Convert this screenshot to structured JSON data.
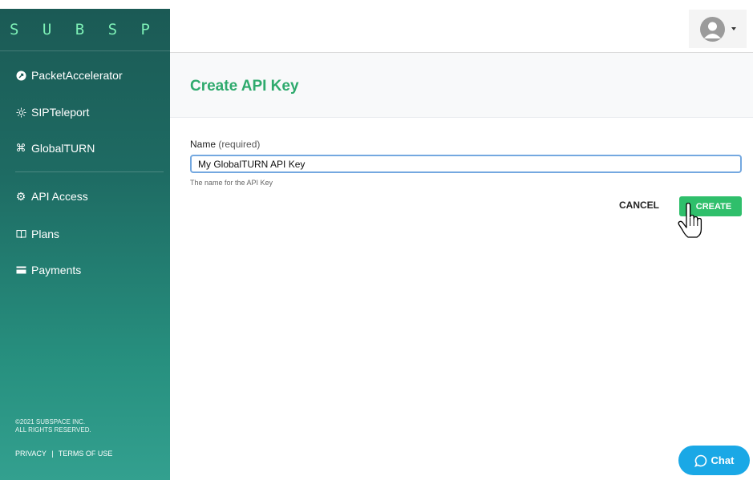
{
  "sidebar": {
    "logo_text": "SUBSPACE",
    "items": [
      {
        "label": "PacketAccelerator",
        "icon": "rocket-icon"
      },
      {
        "label": "SIPTeleport",
        "icon": "sun-icon"
      },
      {
        "label": "GlobalTURN",
        "icon": "command-icon"
      },
      {
        "label": "API Access",
        "icon": "gear-icon"
      },
      {
        "label": "Plans",
        "icon": "book-icon"
      },
      {
        "label": "Payments",
        "icon": "credit-card-icon"
      }
    ],
    "copyright_line1": "©2021 SUBSPACE INC.",
    "copyright_line2": "ALL RIGHTS RESERVED.",
    "privacy": "PRIVACY",
    "separator": "|",
    "terms": "TERMS OF USE"
  },
  "header": {
    "title": "Create API Key"
  },
  "form": {
    "name_label": "Name",
    "required_label": "(required)",
    "name_value": "My GlobalTURN API Key",
    "help_text": "The name for the API Key",
    "cancel_label": "CANCEL",
    "create_label": "CREATE"
  },
  "chat": {
    "label": "Chat"
  },
  "colors": {
    "accent_green": "#2eaa6d",
    "create_button": "#2fbf6b",
    "chat_button": "#1aa8e6",
    "logo_green": "#7df0b6"
  }
}
